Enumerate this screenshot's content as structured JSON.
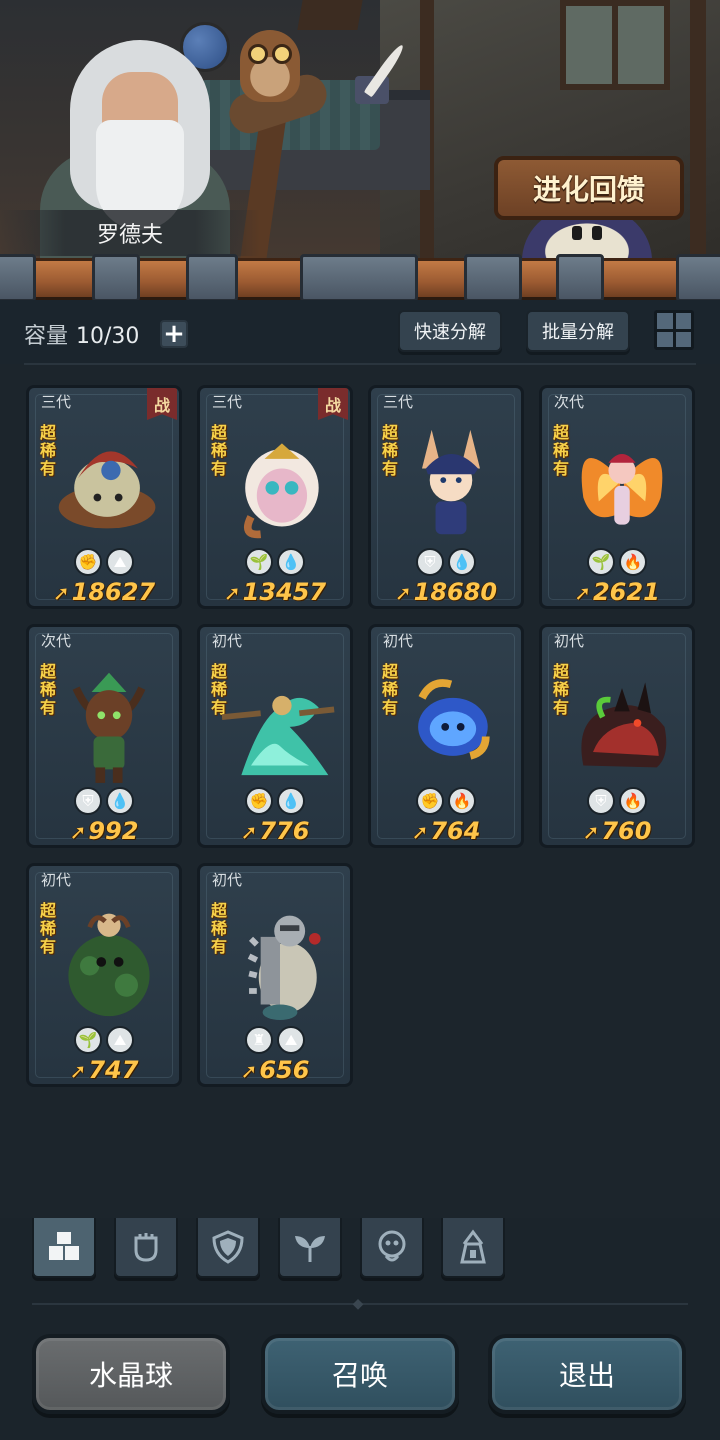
{
  "header": {
    "npc_name": "罗德夫",
    "evolution_button": "进化回馈"
  },
  "toolbar": {
    "capacity_label": "容量",
    "capacity_value": "10/30",
    "quick_decompose": "快速分解",
    "batch_decompose": "批量分解"
  },
  "cards": [
    {
      "gen": "三代",
      "rarity": "超稀有",
      "in_battle": true,
      "battle_label": "战",
      "power": "18627",
      "icons": [
        "fist-icon",
        "earth-icon"
      ]
    },
    {
      "gen": "三代",
      "rarity": "超稀有",
      "in_battle": true,
      "battle_label": "战",
      "power": "13457",
      "icons": [
        "sprout-icon",
        "water-icon"
      ]
    },
    {
      "gen": "三代",
      "rarity": "超稀有",
      "in_battle": false,
      "battle_label": "",
      "power": "18680",
      "icons": [
        "shield-icon",
        "water-icon"
      ]
    },
    {
      "gen": "次代",
      "rarity": "超稀有",
      "in_battle": false,
      "battle_label": "",
      "power": "2621",
      "icons": [
        "sprout-icon",
        "fire-icon"
      ]
    },
    {
      "gen": "次代",
      "rarity": "超稀有",
      "in_battle": false,
      "battle_label": "",
      "power": "992",
      "icons": [
        "shield-icon",
        "water-icon"
      ]
    },
    {
      "gen": "初代",
      "rarity": "超稀有",
      "in_battle": false,
      "battle_label": "",
      "power": "776",
      "icons": [
        "fist-icon",
        "water-icon"
      ]
    },
    {
      "gen": "初代",
      "rarity": "超稀有",
      "in_battle": false,
      "battle_label": "",
      "power": "764",
      "icons": [
        "fist-icon",
        "fire-icon"
      ]
    },
    {
      "gen": "初代",
      "rarity": "超稀有",
      "in_battle": false,
      "battle_label": "",
      "power": "760",
      "icons": [
        "shield-icon",
        "fire-icon"
      ]
    },
    {
      "gen": "初代",
      "rarity": "超稀有",
      "in_battle": false,
      "battle_label": "",
      "power": "747",
      "icons": [
        "sprout-icon",
        "earth-icon"
      ]
    },
    {
      "gen": "初代",
      "rarity": "超稀有",
      "in_battle": false,
      "battle_label": "",
      "power": "656",
      "icons": [
        "tower-icon",
        "earth-icon"
      ]
    }
  ],
  "filters": [
    "all-filter-icon",
    "fist-filter-icon",
    "shield-filter-icon",
    "sprout-filter-icon",
    "spirit-filter-icon",
    "tower-filter-icon"
  ],
  "bottom": {
    "crystal_ball": "水晶球",
    "summon": "召唤",
    "exit": "退出"
  },
  "colors": {
    "power_text": "#ffc54a",
    "rarity_text": "#f7d24a",
    "card_bg": "#2f3f4c",
    "button_teal": "#3e6273"
  }
}
